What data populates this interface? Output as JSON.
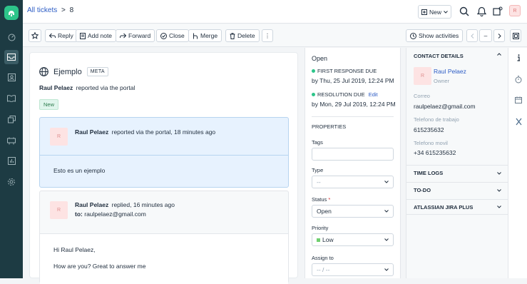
{
  "breadcrumb": {
    "link": "All tickets",
    "separator": ">",
    "ticket_id": "8"
  },
  "topbar": {
    "new_label": "New",
    "avatar_initial": "R"
  },
  "toolbar": {
    "reply": "Reply",
    "add_note": "Add note",
    "forward": "Forward",
    "close": "Close",
    "merge": "Merge",
    "delete": "Delete",
    "more": "⋮",
    "show_activities": "Show activities",
    "minus": "–"
  },
  "ticket": {
    "subject": "Ejemplo",
    "subject_badge": "META",
    "reporter": "Raul Pelaez",
    "reported_via": "reported via the portal",
    "status_tag": "New"
  },
  "conversations": [
    {
      "initial": "R",
      "author": "Raul Pelaez",
      "meta": "reported via the portal, 18 minutes ago",
      "body": "Esto es un ejemplo"
    },
    {
      "initial": "R",
      "author": "Raul Pelaez",
      "meta": "replied, 16 minutes ago",
      "to_label": "to:",
      "to": "raulpelaez@gmail.com",
      "greeting": "Hi Raul Pelaez,",
      "body": "How are you? Great to answer me"
    }
  ],
  "sla": {
    "state": "Open",
    "first_response_label": "FIRST RESPONSE DUE",
    "first_response_value": "by Thu, 25 Jul 2019, 12:24 PM",
    "resolution_label": "RESOLUTION DUE",
    "resolution_edit": "Edit",
    "resolution_value": "by Mon, 29 Jul 2019, 12:24 PM"
  },
  "properties": {
    "heading": "PROPERTIES",
    "tags_label": "Tags",
    "type_label": "Type",
    "type_value": "--",
    "status_label": "Status",
    "status_required": "*",
    "status_value": "Open",
    "priority_label": "Priority",
    "priority_value": "Low",
    "assign_label": "Assign to",
    "assign_value": "-- / --"
  },
  "contact": {
    "heading": "CONTACT DETAILS",
    "initial": "R",
    "name": "Raul Pelaez",
    "role": "Owner",
    "email_label": "Correo",
    "email": "raulpelaez@gmail.com",
    "work_phone_label": "Telefono de trabajo",
    "work_phone": "615235632",
    "mobile_label": "Telefono movil",
    "mobile": "+34 615235632"
  },
  "sections": [
    "TIME LOGS",
    "TO-DO",
    "ATLASSIAN JIRA PLUS"
  ],
  "colors": {
    "nav": "#1d3b43",
    "accent": "#2c5cc5",
    "green": "#2dc58a",
    "required": "#d72d30"
  }
}
